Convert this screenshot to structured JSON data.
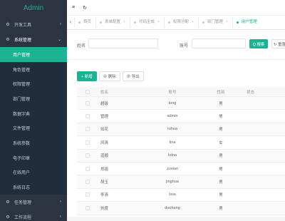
{
  "brand": {
    "title": "Admin"
  },
  "sidebar": {
    "groups": [
      {
        "label": "开发工具",
        "icon": "gear-icon",
        "glyph": "⚙",
        "chev": "‹"
      },
      {
        "label": "系统管理",
        "icon": "gear-icon",
        "glyph": "⚙",
        "chev": "⌄"
      },
      {
        "label": "任务管理",
        "icon": "gear-icon",
        "glyph": "⚙",
        "chev": "‹"
      },
      {
        "label": "工作流程",
        "icon": "gear-icon",
        "glyph": "⚙",
        "chev": "‹"
      }
    ],
    "items": [
      {
        "label": "用户管理",
        "active": true
      },
      {
        "label": "角色管理"
      },
      {
        "label": "权限管理"
      },
      {
        "label": "部门管理"
      },
      {
        "label": "数据字典"
      },
      {
        "label": "文件管理"
      },
      {
        "label": "系统参数"
      },
      {
        "label": "电子印章"
      },
      {
        "label": "在线用户"
      },
      {
        "label": "系统日志"
      }
    ]
  },
  "topbar": {
    "menu_glyph": "≡",
    "refresh_glyph": "↻"
  },
  "tabs": {
    "prev_glyph": "‹",
    "items": [
      {
        "label": "首页"
      },
      {
        "label": "表单配置"
      },
      {
        "label": "代码生成"
      },
      {
        "label": "权限分配"
      },
      {
        "label": "部门管理"
      },
      {
        "label": "用户管理",
        "active": true
      }
    ],
    "close_glyph": "×"
  },
  "search": {
    "name_label": "姓名",
    "name_value": "",
    "account_label": "账号",
    "account_value": "",
    "search_label": "Q 搜索",
    "reset_label": "↻ 重置"
  },
  "toolbar": {
    "add_label": "+ 新增",
    "delete_label": "⊗ 删除",
    "export_label": "⊕ 导出"
  },
  "table": {
    "headers": {
      "name": "姓名",
      "account": "账号",
      "gender": "性别",
      "status": "状态"
    },
    "rows": [
      {
        "name": "超级",
        "account": "tong",
        "gender": "男",
        "status": ""
      },
      {
        "name": "管理",
        "account": "admin",
        "gender": "男",
        "status": ""
      },
      {
        "name": "如花",
        "account": "ruhua",
        "gender": "男",
        "status": ""
      },
      {
        "name": "风清",
        "account": "tina",
        "gender": "女",
        "status": ""
      },
      {
        "name": "道顺",
        "account": "kdna",
        "gender": "男",
        "status": ""
      },
      {
        "name": "郑祖",
        "account": "zuxian",
        "gender": "男",
        "status": ""
      },
      {
        "name": "胡玉",
        "account": "jinghua",
        "gender": "男",
        "status": ""
      },
      {
        "name": "李清",
        "account": "lixia",
        "gender": "男",
        "status": ""
      },
      {
        "name": "刘度",
        "account": "duohang",
        "gender": "男",
        "status": ""
      }
    ]
  },
  "colors": {
    "accent": "#1ab394",
    "sidebar_bg": "#2b3440",
    "submenu_bg": "#1f2d3d"
  }
}
